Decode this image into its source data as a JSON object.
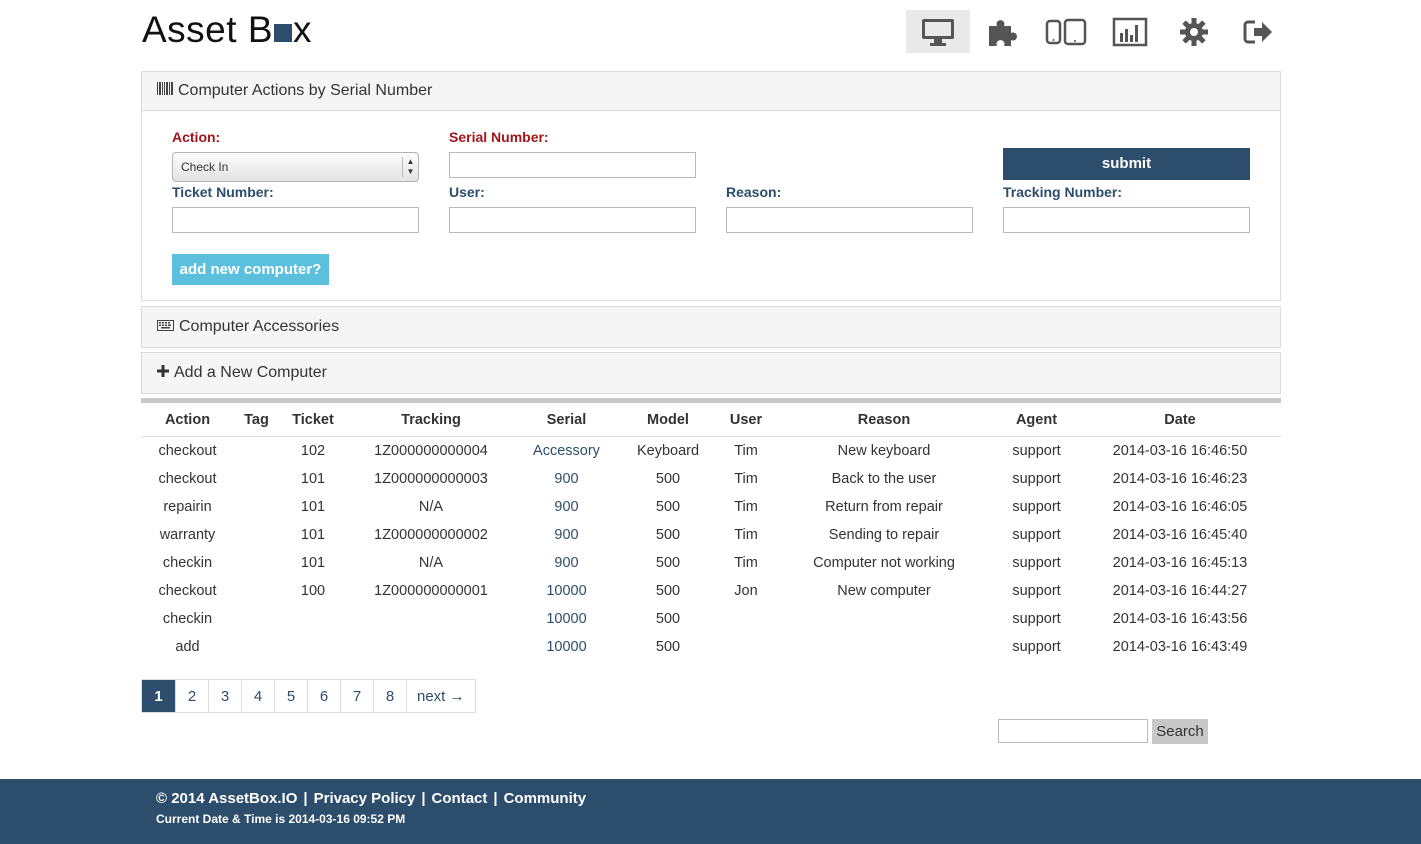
{
  "brand": {
    "logo_prefix": "Asset B",
    "logo_suffix": "x"
  },
  "colors": {
    "primary": "#2c4e6c",
    "required": "#a0161b",
    "accent": "#5bc0de"
  },
  "nav": {
    "icons": [
      "desktop-icon",
      "puzzle-icon",
      "devices-icon",
      "bar-chart-icon",
      "gear-icon",
      "logout-icon"
    ],
    "active": "desktop-icon"
  },
  "panels": {
    "serial_actions": {
      "title": "Computer Actions by Serial Number",
      "icon": "barcode-icon"
    },
    "accessories": {
      "title": "Computer Accessories",
      "icon": "keyboard-icon"
    },
    "add_computer": {
      "title": "Add a New Computer",
      "icon": "plus-icon"
    }
  },
  "form": {
    "action_label": "Action:",
    "action_value": "Check In",
    "serial_label": "Serial Number:",
    "serial_value": "",
    "submit_label": "submit",
    "ticket_label": "Ticket Number:",
    "user_label": "User:",
    "reason_label": "Reason:",
    "tracking_label": "Tracking Number:",
    "add_new_label": "add new computer?"
  },
  "table": {
    "headers": [
      "Action",
      "Tag",
      "Ticket",
      "Tracking",
      "Serial",
      "Model",
      "User",
      "Reason",
      "Agent",
      "Date"
    ],
    "rows": [
      [
        "checkout",
        "",
        "102",
        "1Z000000000004",
        "Accessory",
        "Keyboard",
        "Tim",
        "New keyboard",
        "support",
        "2014-03-16 16:46:50"
      ],
      [
        "checkout",
        "",
        "101",
        "1Z000000000003",
        "900",
        "500",
        "Tim",
        "Back to the user",
        "support",
        "2014-03-16 16:46:23"
      ],
      [
        "repairin",
        "",
        "101",
        "N/A",
        "900",
        "500",
        "Tim",
        "Return from repair",
        "support",
        "2014-03-16 16:46:05"
      ],
      [
        "warranty",
        "",
        "101",
        "1Z000000000002",
        "900",
        "500",
        "Tim",
        "Sending to repair",
        "support",
        "2014-03-16 16:45:40"
      ],
      [
        "checkin",
        "",
        "101",
        "N/A",
        "900",
        "500",
        "Tim",
        "Computer not working",
        "support",
        "2014-03-16 16:45:13"
      ],
      [
        "checkout",
        "",
        "100",
        "1Z000000000001",
        "10000",
        "500",
        "Jon",
        "New computer",
        "support",
        "2014-03-16 16:44:27"
      ],
      [
        "checkin",
        "",
        "",
        "",
        "10000",
        "500",
        "",
        "",
        "support",
        "2014-03-16 16:43:56"
      ],
      [
        "add",
        "",
        "",
        "",
        "10000",
        "500",
        "",
        "",
        "support",
        "2014-03-16 16:43:49"
      ]
    ]
  },
  "pagination": {
    "pages": [
      "1",
      "2",
      "3",
      "4",
      "5",
      "6",
      "7",
      "8"
    ],
    "active": "1",
    "next_label": "next →"
  },
  "search": {
    "button_label": "Search",
    "value": ""
  },
  "footer": {
    "copyright": "© 2014 AssetBox.IO",
    "links": [
      "Privacy Policy",
      "Contact",
      "Community"
    ],
    "separator": "|",
    "datetime": "Current Date & Time is 2014-03-16 09:52 PM"
  }
}
